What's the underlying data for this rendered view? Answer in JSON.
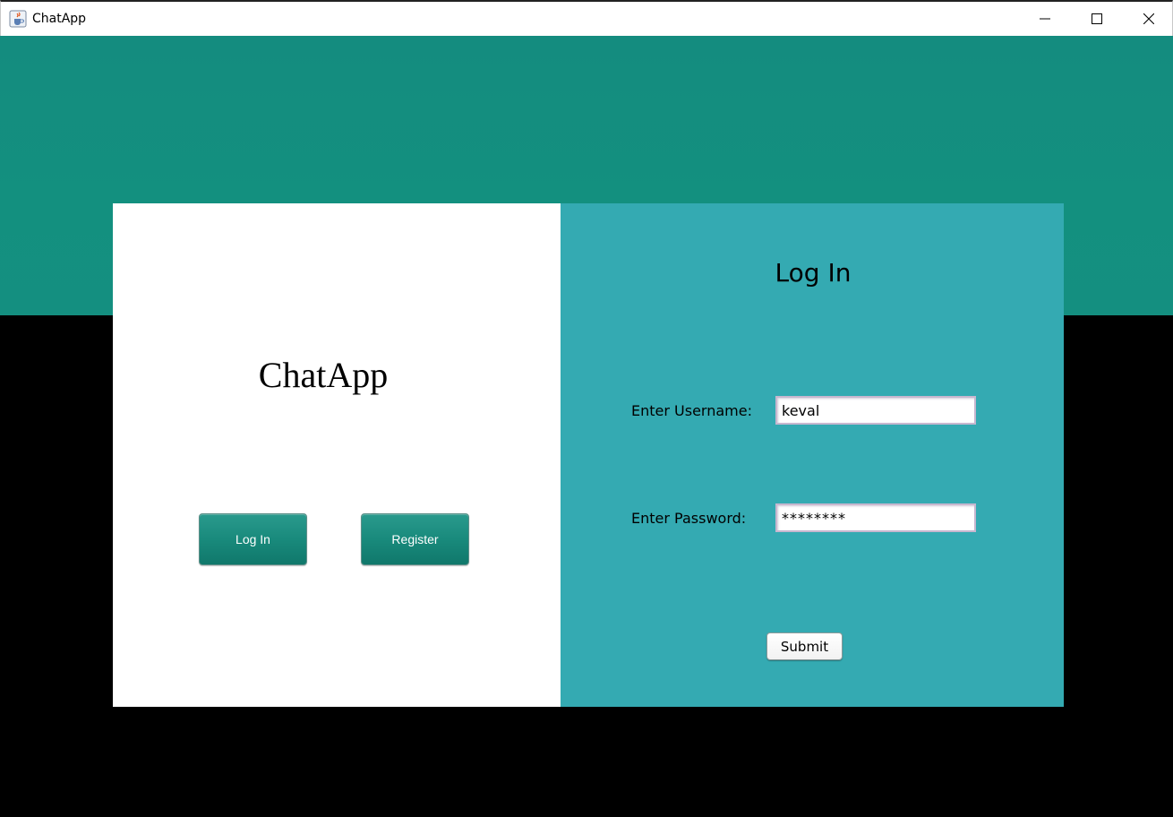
{
  "window": {
    "title": "ChatApp",
    "icon": "java-cup-icon",
    "controls": [
      "minimize-icon",
      "maximize-icon",
      "close-icon"
    ]
  },
  "brand": {
    "title": "ChatApp"
  },
  "nav": {
    "login_label": "Log In",
    "register_label": "Register"
  },
  "form": {
    "title": "Log In",
    "username_label": "Enter Username:",
    "username_value": "keval",
    "password_label": "Enter Password:",
    "password_value": "********",
    "submit_label": "Submit"
  },
  "colors": {
    "header_teal": "#13907f",
    "panel_teal": "#34aab2",
    "button_teal": "#198a7c",
    "background": "#000000"
  }
}
